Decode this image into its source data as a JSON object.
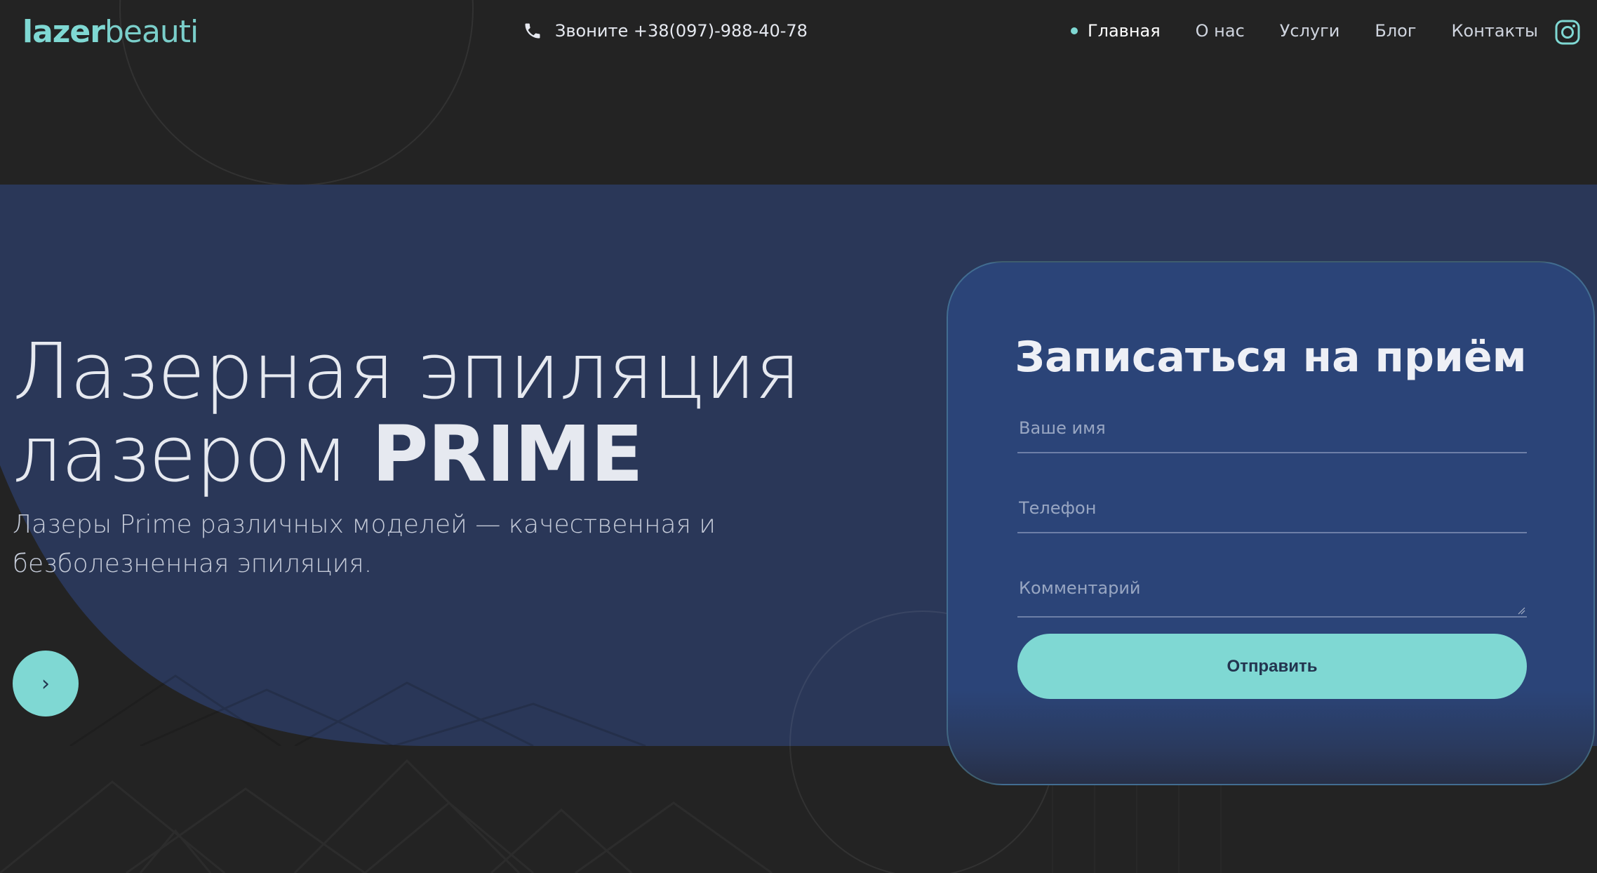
{
  "header": {
    "logo_bold": "lazer",
    "logo_light": "beauti",
    "phone": "Звоните +38(097)-988-40-78",
    "nav": [
      {
        "label": "Главная",
        "active": true
      },
      {
        "label": "О нас",
        "active": false
      },
      {
        "label": "Услуги",
        "active": false
      },
      {
        "label": "Блог",
        "active": false
      },
      {
        "label": "Контакты",
        "active": false
      }
    ],
    "social_icon": "instagram-icon"
  },
  "hero": {
    "title_line1": "Лазерная эпиляция",
    "title_line2_light": "лазером ",
    "title_line2_bold": "PRIME",
    "subtitle": "Лазеры Prime различных моделей — качественная и безболезненная эпиляция.",
    "arrow_label": "›"
  },
  "form": {
    "title": "Записаться на приём",
    "name_placeholder": "Ваше имя",
    "phone_placeholder": "Телефон",
    "comment_placeholder": "Комментарий",
    "submit_label": "Отправить"
  },
  "colors": {
    "background": "#232323",
    "hero": "#2a3758",
    "card": "#2b4478",
    "accent": "#7fd8d3"
  }
}
